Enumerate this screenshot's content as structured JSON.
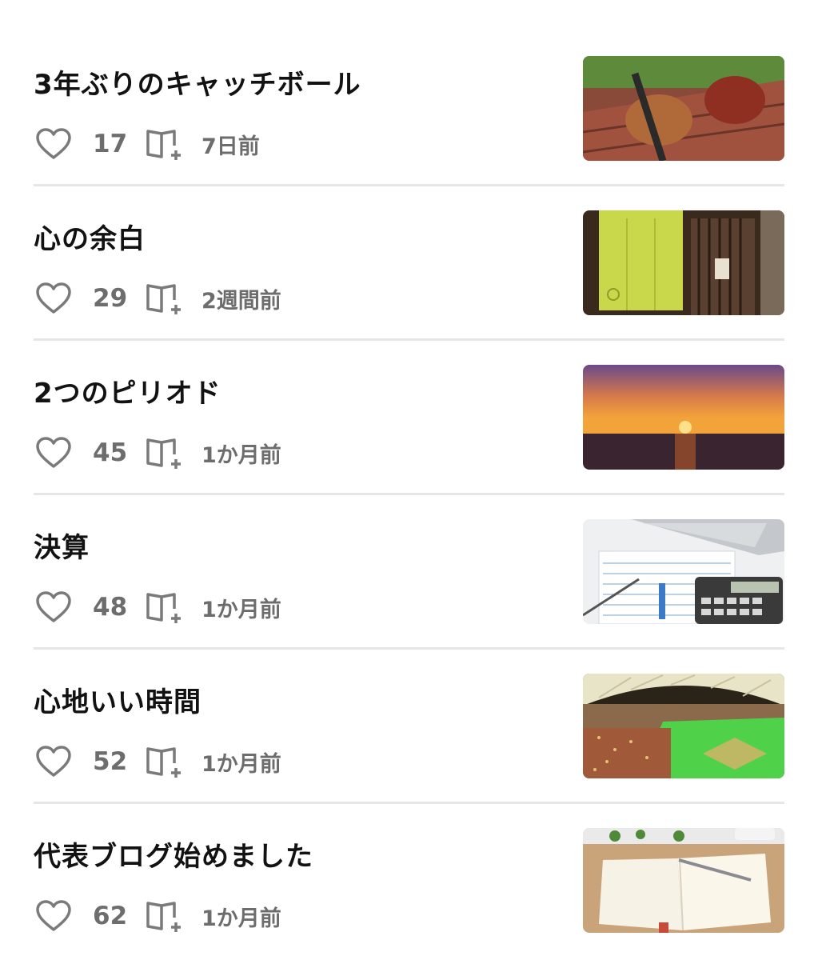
{
  "articles": [
    {
      "title": "3年ぶりのキャッチボール",
      "likes": "17",
      "time": "7日前",
      "thumbnail": "baseball-gloves-photo"
    },
    {
      "title": "心の余白",
      "likes": "29",
      "time": "2週間前",
      "thumbnail": "noren-curtain-photo"
    },
    {
      "title": "2つのピリオド",
      "likes": "45",
      "time": "1か月前",
      "thumbnail": "sunset-sea-photo"
    },
    {
      "title": "決算",
      "likes": "48",
      "time": "1か月前",
      "thumbnail": "tax-form-calculator-photo"
    },
    {
      "title": "心地いい時間",
      "likes": "52",
      "time": "1か月前",
      "thumbnail": "baseball-stadium-photo"
    },
    {
      "title": "代表ブログ始めました",
      "likes": "62",
      "time": "1か月前",
      "thumbnail": "notebook-pen-photo"
    }
  ],
  "icons": {
    "like": "heart-icon",
    "save": "book-plus-icon"
  },
  "colors": {
    "title": "#121212",
    "meta": "#6d6d6d",
    "divider": "#e6e6e6"
  }
}
